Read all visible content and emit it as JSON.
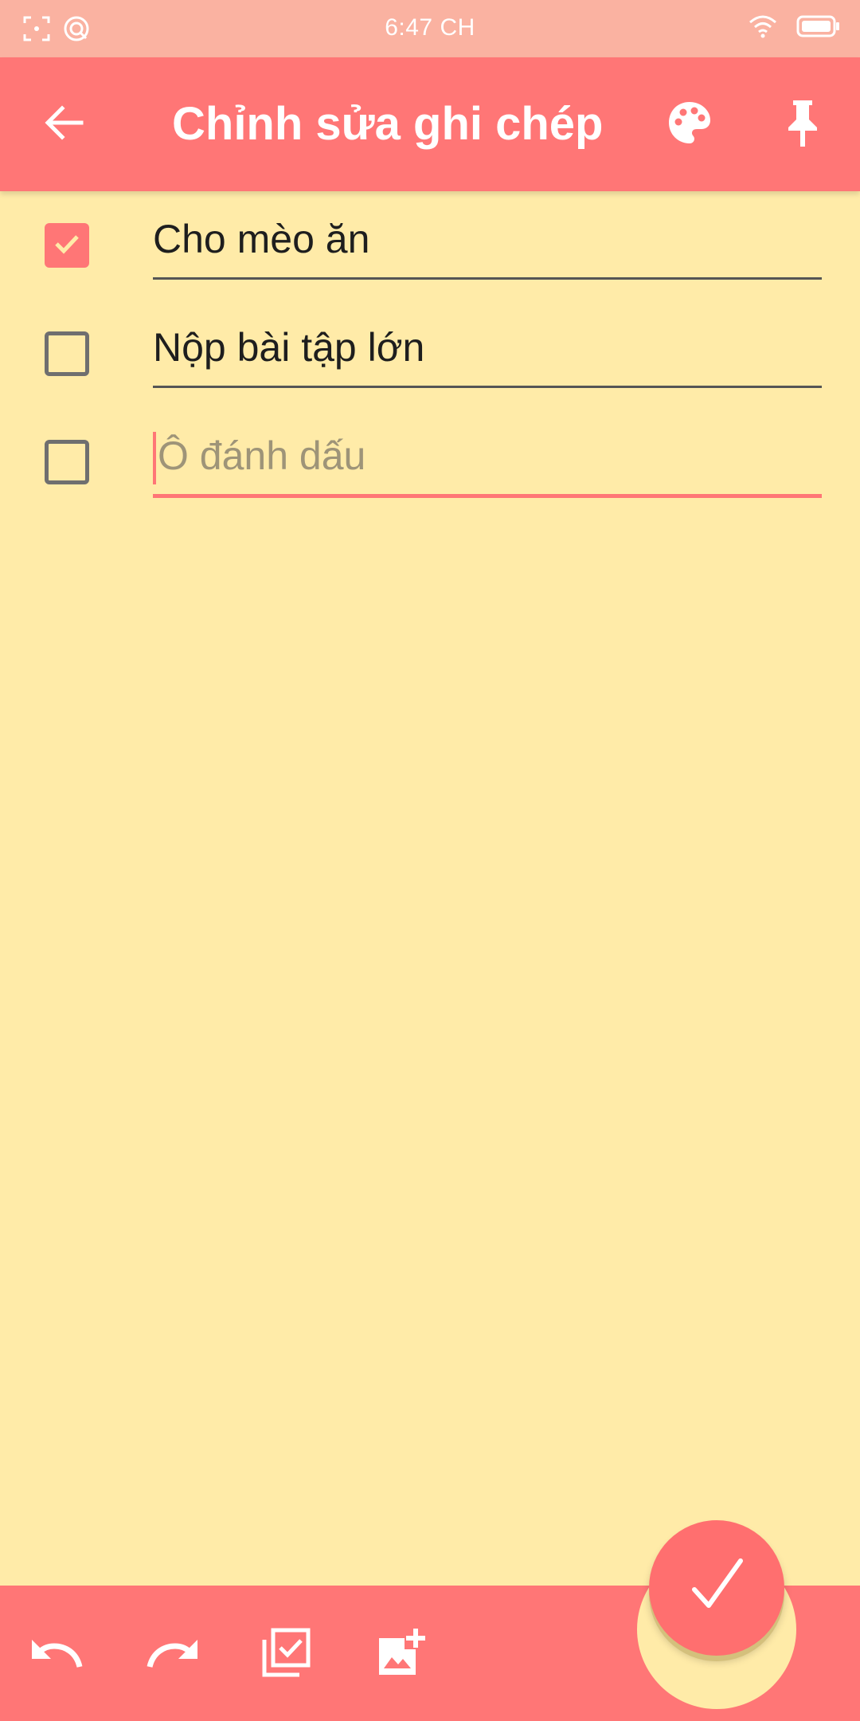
{
  "status_bar": {
    "time": "6:47 CH"
  },
  "app_bar": {
    "title": "Chỉnh sửa ghi chép",
    "back_icon": "arrow-back-icon",
    "palette_icon": "palette-icon",
    "pin_icon": "pin-icon"
  },
  "checklist": {
    "items": [
      {
        "text": "Cho mèo ăn",
        "checked": true
      },
      {
        "text": "Nộp bài tập lớn",
        "checked": false
      }
    ],
    "new_item_placeholder": "Ô đánh dấu"
  },
  "bottom_bar": {
    "tools": [
      "undo-icon",
      "redo-icon",
      "add-checklist-icon",
      "add-image-icon"
    ],
    "fab_icon": "checkmark-icon"
  },
  "colors": {
    "accent": "#FF7676",
    "background": "#FFEBA8",
    "status_bar": "#FAB2A1"
  }
}
